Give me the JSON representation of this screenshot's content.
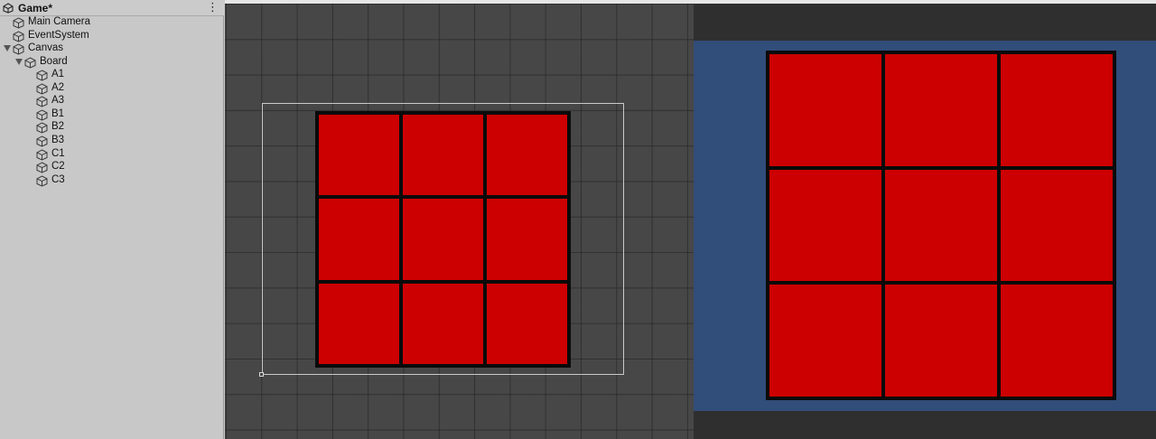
{
  "hierarchy": {
    "scene_name": "Game*",
    "menu_glyph": "⋮",
    "items": [
      {
        "label": "Main Camera",
        "depth": 0,
        "foldout": "none"
      },
      {
        "label": "EventSystem",
        "depth": 0,
        "foldout": "none"
      },
      {
        "label": "Canvas",
        "depth": 0,
        "foldout": "expanded"
      },
      {
        "label": "Board",
        "depth": 1,
        "foldout": "expanded"
      },
      {
        "label": "A1",
        "depth": 2,
        "foldout": "none"
      },
      {
        "label": "A2",
        "depth": 2,
        "foldout": "none"
      },
      {
        "label": "A3",
        "depth": 2,
        "foldout": "none"
      },
      {
        "label": "B1",
        "depth": 2,
        "foldout": "none"
      },
      {
        "label": "B2",
        "depth": 2,
        "foldout": "none"
      },
      {
        "label": "B3",
        "depth": 2,
        "foldout": "none"
      },
      {
        "label": "C1",
        "depth": 2,
        "foldout": "none"
      },
      {
        "label": "C2",
        "depth": 2,
        "foldout": "none"
      },
      {
        "label": "C3",
        "depth": 2,
        "foldout": "none"
      }
    ]
  },
  "board": {
    "rows": 3,
    "cols": 3,
    "cell_ids": [
      "A1",
      "A2",
      "A3",
      "B1",
      "B2",
      "B3",
      "C1",
      "C2",
      "C3"
    ]
  },
  "colors": {
    "cell": "#cc0000",
    "board_border": "#0a0a0a",
    "game_background": "#314d79",
    "scene_background": "#474747"
  }
}
